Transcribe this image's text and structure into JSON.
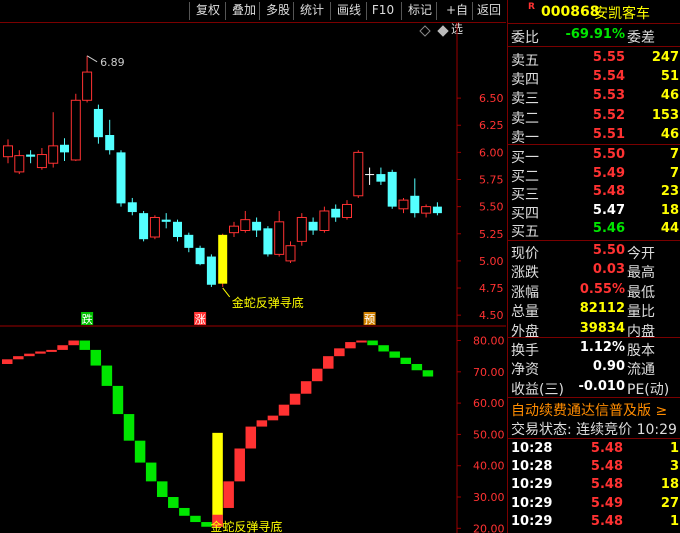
{
  "toolbar": {
    "buttons": [
      "复权",
      "叠加",
      "多股",
      "统计",
      "画线",
      "F10",
      "标记",
      "+自选",
      "返回"
    ]
  },
  "stock": {
    "code": "000868",
    "name": "安凯客车",
    "r_badge": "R"
  },
  "weibi": {
    "label": "委比",
    "value": "-69.91%",
    "label2": "委差"
  },
  "asks": [
    {
      "label": "卖五",
      "price": "5.55",
      "vol": "247"
    },
    {
      "label": "卖四",
      "price": "5.54",
      "vol": "51"
    },
    {
      "label": "卖三",
      "price": "5.53",
      "vol": "46"
    },
    {
      "label": "卖二",
      "price": "5.52",
      "vol": "153"
    },
    {
      "label": "卖一",
      "price": "5.51",
      "vol": "46"
    }
  ],
  "bids": [
    {
      "label": "买一",
      "price": "5.50",
      "vol": "7"
    },
    {
      "label": "买二",
      "price": "5.49",
      "vol": "7"
    },
    {
      "label": "买三",
      "price": "5.48",
      "vol": "23"
    },
    {
      "label": "买四",
      "price": "5.47",
      "vol": "18"
    },
    {
      "label": "买五",
      "price": "5.46",
      "vol": "44"
    }
  ],
  "quote": [
    {
      "label": "现价",
      "value": "5.50",
      "label2": "今开"
    },
    {
      "label": "涨跌",
      "value": "0.03",
      "label2": "最高"
    },
    {
      "label": "涨幅",
      "value": "0.55%",
      "label2": "最低"
    },
    {
      "label": "总量",
      "value": "82112",
      "label2": "量比"
    },
    {
      "label": "外盘",
      "value": "39834",
      "label2": "内盘"
    }
  ],
  "stats": [
    {
      "label": "换手",
      "value": "1.12%",
      "label2": "股本"
    },
    {
      "label": "净资",
      "value": "0.90",
      "label2": "流通"
    },
    {
      "label": "收益(三)",
      "value": "-0.010",
      "label2": "PE(动)"
    }
  ],
  "news": "自动续费通达信普及版 ≥",
  "trade_status": "交易状态: 连续竞价 10:29",
  "ticks": [
    {
      "time": "10:28",
      "price": "5.48",
      "vol": "1"
    },
    {
      "time": "10:28",
      "price": "5.48",
      "vol": "3"
    },
    {
      "time": "10:29",
      "price": "5.48",
      "vol": "18"
    },
    {
      "time": "10:29",
      "price": "5.49",
      "vol": "27"
    },
    {
      "time": "10:29",
      "price": "5.48",
      "vol": "1"
    }
  ],
  "chart_data": [
    {
      "type": "candlestick",
      "ylim": [
        4.4,
        7.1
      ],
      "yticks": [
        "6.50",
        "6.25",
        "6.00",
        "5.75",
        "5.50",
        "5.25",
        "5.00",
        "4.75",
        "4.50"
      ],
      "high_label": "6.89",
      "annotation": "金蛇反弹寻底",
      "markers": [
        {
          "text": "跌",
          "index": 7,
          "color": "#00c000"
        },
        {
          "text": "涨",
          "index": 17,
          "color": "#ff3232"
        },
        {
          "text": "预",
          "index": 32,
          "color": "#d08000"
        }
      ],
      "candles": [
        {
          "o": 5.96,
          "c": 6.06,
          "h": 6.12,
          "l": 5.9
        },
        {
          "o": 5.82,
          "c": 5.97,
          "h": 6.02,
          "l": 5.8
        },
        {
          "o": 5.98,
          "c": 5.96,
          "h": 6.02,
          "l": 5.9
        },
        {
          "o": 5.86,
          "c": 5.98,
          "h": 6.04,
          "l": 5.84
        },
        {
          "o": 5.9,
          "c": 6.06,
          "h": 6.37,
          "l": 5.86
        },
        {
          "o": 6.07,
          "c": 6.0,
          "h": 6.13,
          "l": 5.92
        },
        {
          "o": 5.93,
          "c": 6.48,
          "h": 6.54,
          "l": 5.92
        },
        {
          "o": 6.48,
          "c": 6.74,
          "h": 6.89,
          "l": 6.46
        },
        {
          "o": 6.4,
          "c": 6.14,
          "h": 6.44,
          "l": 6.08
        },
        {
          "o": 6.16,
          "c": 6.02,
          "h": 6.3,
          "l": 5.98
        },
        {
          "o": 6.0,
          "c": 5.53,
          "h": 6.02,
          "l": 5.5
        },
        {
          "o": 5.54,
          "c": 5.45,
          "h": 5.58,
          "l": 5.42
        },
        {
          "o": 5.44,
          "c": 5.2,
          "h": 5.46,
          "l": 5.18
        },
        {
          "o": 5.22,
          "c": 5.4,
          "h": 5.42,
          "l": 5.2
        },
        {
          "o": 5.38,
          "c": 5.36,
          "h": 5.44,
          "l": 5.3
        },
        {
          "o": 5.36,
          "c": 5.22,
          "h": 5.38,
          "l": 5.18
        },
        {
          "o": 5.24,
          "c": 5.12,
          "h": 5.26,
          "l": 5.08
        },
        {
          "o": 5.12,
          "c": 4.97,
          "h": 5.14,
          "l": 4.96
        },
        {
          "o": 5.04,
          "c": 4.78,
          "h": 5.06,
          "l": 4.76
        },
        {
          "o": 4.79,
          "c": 5.24,
          "h": 5.25,
          "l": 4.76
        },
        {
          "o": 5.26,
          "c": 5.32,
          "h": 5.36,
          "l": 5.22
        },
        {
          "o": 5.28,
          "c": 5.38,
          "h": 5.46,
          "l": 5.26
        },
        {
          "o": 5.36,
          "c": 5.28,
          "h": 5.4,
          "l": 5.22
        },
        {
          "o": 5.3,
          "c": 5.06,
          "h": 5.32,
          "l": 5.04
        },
        {
          "o": 5.06,
          "c": 5.36,
          "h": 5.46,
          "l": 5.04
        },
        {
          "o": 5.0,
          "c": 5.14,
          "h": 5.18,
          "l": 4.98
        },
        {
          "o": 5.18,
          "c": 5.4,
          "h": 5.44,
          "l": 5.14
        },
        {
          "o": 5.36,
          "c": 5.28,
          "h": 5.4,
          "l": 5.24
        },
        {
          "o": 5.28,
          "c": 5.46,
          "h": 5.5,
          "l": 5.26
        },
        {
          "o": 5.48,
          "c": 5.4,
          "h": 5.52,
          "l": 5.36
        },
        {
          "o": 5.4,
          "c": 5.52,
          "h": 5.56,
          "l": 5.38
        },
        {
          "o": 5.6,
          "c": 6.0,
          "h": 6.02,
          "l": 5.58
        },
        {
          "o": 5.8,
          "c": 5.8,
          "h": 5.86,
          "l": 5.7
        },
        {
          "o": 5.8,
          "c": 5.73,
          "h": 5.86,
          "l": 5.7
        },
        {
          "o": 5.82,
          "c": 5.5,
          "h": 5.84,
          "l": 5.48
        },
        {
          "o": 5.48,
          "c": 5.56,
          "h": 5.58,
          "l": 5.44
        },
        {
          "o": 5.6,
          "c": 5.44,
          "h": 5.76,
          "l": 5.4
        },
        {
          "o": 5.44,
          "c": 5.5,
          "h": 5.52,
          "l": 5.4
        },
        {
          "o": 5.5,
          "c": 5.44,
          "h": 5.54,
          "l": 5.42
        }
      ]
    },
    {
      "type": "bar",
      "ylim": [
        18.5,
        84
      ],
      "yticks": [
        "80.00",
        "70.00",
        "60.00",
        "50.00",
        "40.00",
        "30.00",
        "20.00"
      ],
      "annotation": "金蛇反弹寻底",
      "bars": [
        {
          "from": 72.5,
          "to": 74.0,
          "c": "r"
        },
        {
          "from": 74.0,
          "to": 75.0,
          "c": "r"
        },
        {
          "from": 75.0,
          "to": 75.8,
          "c": "r"
        },
        {
          "from": 75.8,
          "to": 76.5,
          "c": "r"
        },
        {
          "from": 76.5,
          "to": 77.0,
          "c": "r"
        },
        {
          "from": 77.0,
          "to": 78.5,
          "c": "r"
        },
        {
          "from": 78.5,
          "to": 80.0,
          "c": "r"
        },
        {
          "from": 80.0,
          "to": 77.0,
          "c": "g"
        },
        {
          "from": 77.0,
          "to": 72.0,
          "c": "g"
        },
        {
          "from": 72.0,
          "to": 65.5,
          "c": "g"
        },
        {
          "from": 65.5,
          "to": 56.5,
          "c": "g"
        },
        {
          "from": 56.5,
          "to": 48.0,
          "c": "g"
        },
        {
          "from": 48.0,
          "to": 41.0,
          "c": "g"
        },
        {
          "from": 41.0,
          "to": 35.0,
          "c": "g"
        },
        {
          "from": 35.0,
          "to": 30.0,
          "c": "g"
        },
        {
          "from": 30.0,
          "to": 26.5,
          "c": "g"
        },
        {
          "from": 26.5,
          "to": 24.0,
          "c": "g"
        },
        {
          "from": 24.0,
          "to": 22.0,
          "c": "g"
        },
        {
          "from": 22.0,
          "to": 20.5,
          "c": "g"
        },
        {
          "from": 20.5,
          "to": 50.5,
          "c": "y"
        },
        {
          "from": 26.5,
          "to": 35.0,
          "c": "r"
        },
        {
          "from": 35.0,
          "to": 45.5,
          "c": "r"
        },
        {
          "from": 45.5,
          "to": 52.5,
          "c": "r"
        },
        {
          "from": 52.5,
          "to": 54.5,
          "c": "r"
        },
        {
          "from": 54.5,
          "to": 56.0,
          "c": "r"
        },
        {
          "from": 56.0,
          "to": 59.5,
          "c": "r"
        },
        {
          "from": 59.5,
          "to": 63.0,
          "c": "r"
        },
        {
          "from": 63.0,
          "to": 67.0,
          "c": "r"
        },
        {
          "from": 67.0,
          "to": 71.0,
          "c": "r"
        },
        {
          "from": 71.0,
          "to": 75.0,
          "c": "r"
        },
        {
          "from": 75.0,
          "to": 77.5,
          "c": "r"
        },
        {
          "from": 77.5,
          "to": 79.5,
          "c": "r"
        },
        {
          "from": 79.5,
          "to": 80.0,
          "c": "r"
        },
        {
          "from": 80.0,
          "to": 78.5,
          "c": "g"
        },
        {
          "from": 78.5,
          "to": 76.5,
          "c": "g"
        },
        {
          "from": 76.5,
          "to": 74.5,
          "c": "g"
        },
        {
          "from": 74.5,
          "to": 72.5,
          "c": "g"
        },
        {
          "from": 72.5,
          "to": 70.5,
          "c": "g"
        },
        {
          "from": 70.5,
          "to": 68.5,
          "c": "g"
        }
      ]
    }
  ]
}
